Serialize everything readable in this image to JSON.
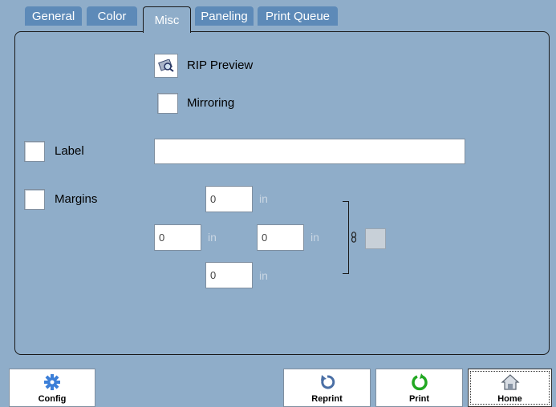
{
  "tabs": {
    "general": "General",
    "color": "Color",
    "misc": "Misc",
    "paneling": "Paneling",
    "print_queue": "Print Queue"
  },
  "misc": {
    "rip_preview_label": "RIP Preview",
    "mirroring_label": "Mirroring",
    "label_label": "Label",
    "label_value": "",
    "margins_label": "Margins",
    "margin_top": "0",
    "margin_left": "0",
    "margin_right": "0",
    "margin_bottom": "0",
    "unit": "in"
  },
  "buttons": {
    "config": "Config",
    "reprint": "Reprint",
    "print": "Print",
    "home": "Home"
  },
  "colors": {
    "background": "#8fadc9",
    "tab": "#5d8ab8",
    "reprint_icon": "#4a6fa5",
    "print_icon": "#22a822"
  },
  "icons": {
    "rip_preview": "magnifier-icon",
    "link": "chain-link-icon",
    "config": "gear-icon",
    "reprint": "refresh-arrow-icon",
    "print": "circular-arrow-icon",
    "home": "house-icon"
  }
}
